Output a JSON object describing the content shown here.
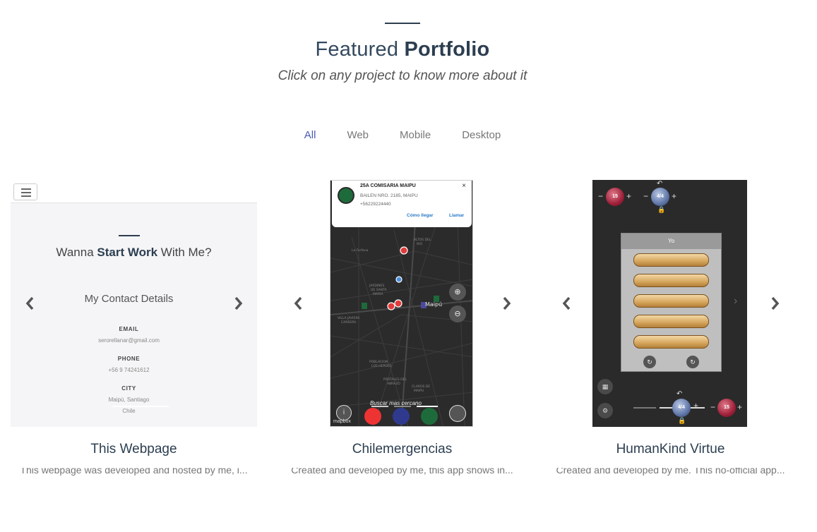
{
  "header": {
    "title_light": "Featured ",
    "title_bold": "Portfolio",
    "subtitle": "Click on any project to know more about it"
  },
  "filters": [
    {
      "label": "All",
      "active": true
    },
    {
      "label": "Web",
      "active": false
    },
    {
      "label": "Mobile",
      "active": false
    },
    {
      "label": "Desktop",
      "active": false
    }
  ],
  "projects": [
    {
      "title": "This Webpage",
      "description": "This webpage was developed and hosted by me, i...",
      "preview": {
        "heading_pre": "Wanna ",
        "heading_bold": "Start Work",
        "heading_post": " With Me?",
        "contact_title": "My Contact Details",
        "email_label": "EMAIL",
        "email_value": "serorellanar@gmail.com",
        "phone_label": "PHONE",
        "phone_value": "+56 9 74241612",
        "city_label": "CITY",
        "city_value": "Maipú, Santiago",
        "country_value": "Chile"
      }
    },
    {
      "title": "Chilemergencias",
      "description": "Created and developed by me, this app shows in...",
      "preview": {
        "place_name": "25A COMISARIA MAIPU",
        "place_address": "BAILEN NRO. 2185, MAIPU",
        "place_phone": "+56229224440",
        "link_directions": "Cómo llegar",
        "link_call": "Llamar",
        "close_glyph": "×",
        "search_hint": "Buscar mas cercano",
        "map_attribution": "mapbox",
        "map_labels": [
          "La Farfana",
          "ALTOS DEL RIO",
          "JARDINES DE SANTA MARIA",
          "Maipú",
          "VILLA JAVIERA CARRERA",
          "POBLACION LOS HEROES",
          "PORTALES DEL ABRAZO",
          "CLAROS DE MAIPU"
        ]
      }
    },
    {
      "title": "HumanKind Virtue",
      "description": "Created and developed by me. This no-official app...",
      "preview": {
        "top_left_value": "15",
        "top_right_value": "4/4",
        "board_title": "Yo",
        "bottom_mid_value": "4/4",
        "bottom_right_value": "15",
        "plus": "+",
        "minus": "−"
      }
    }
  ],
  "colors": {
    "accent": "#4a5bb0",
    "heading": "#2c3e50",
    "muted": "#777777"
  },
  "icons": {
    "prev": "chevron-left-icon",
    "next": "chevron-right-icon"
  }
}
